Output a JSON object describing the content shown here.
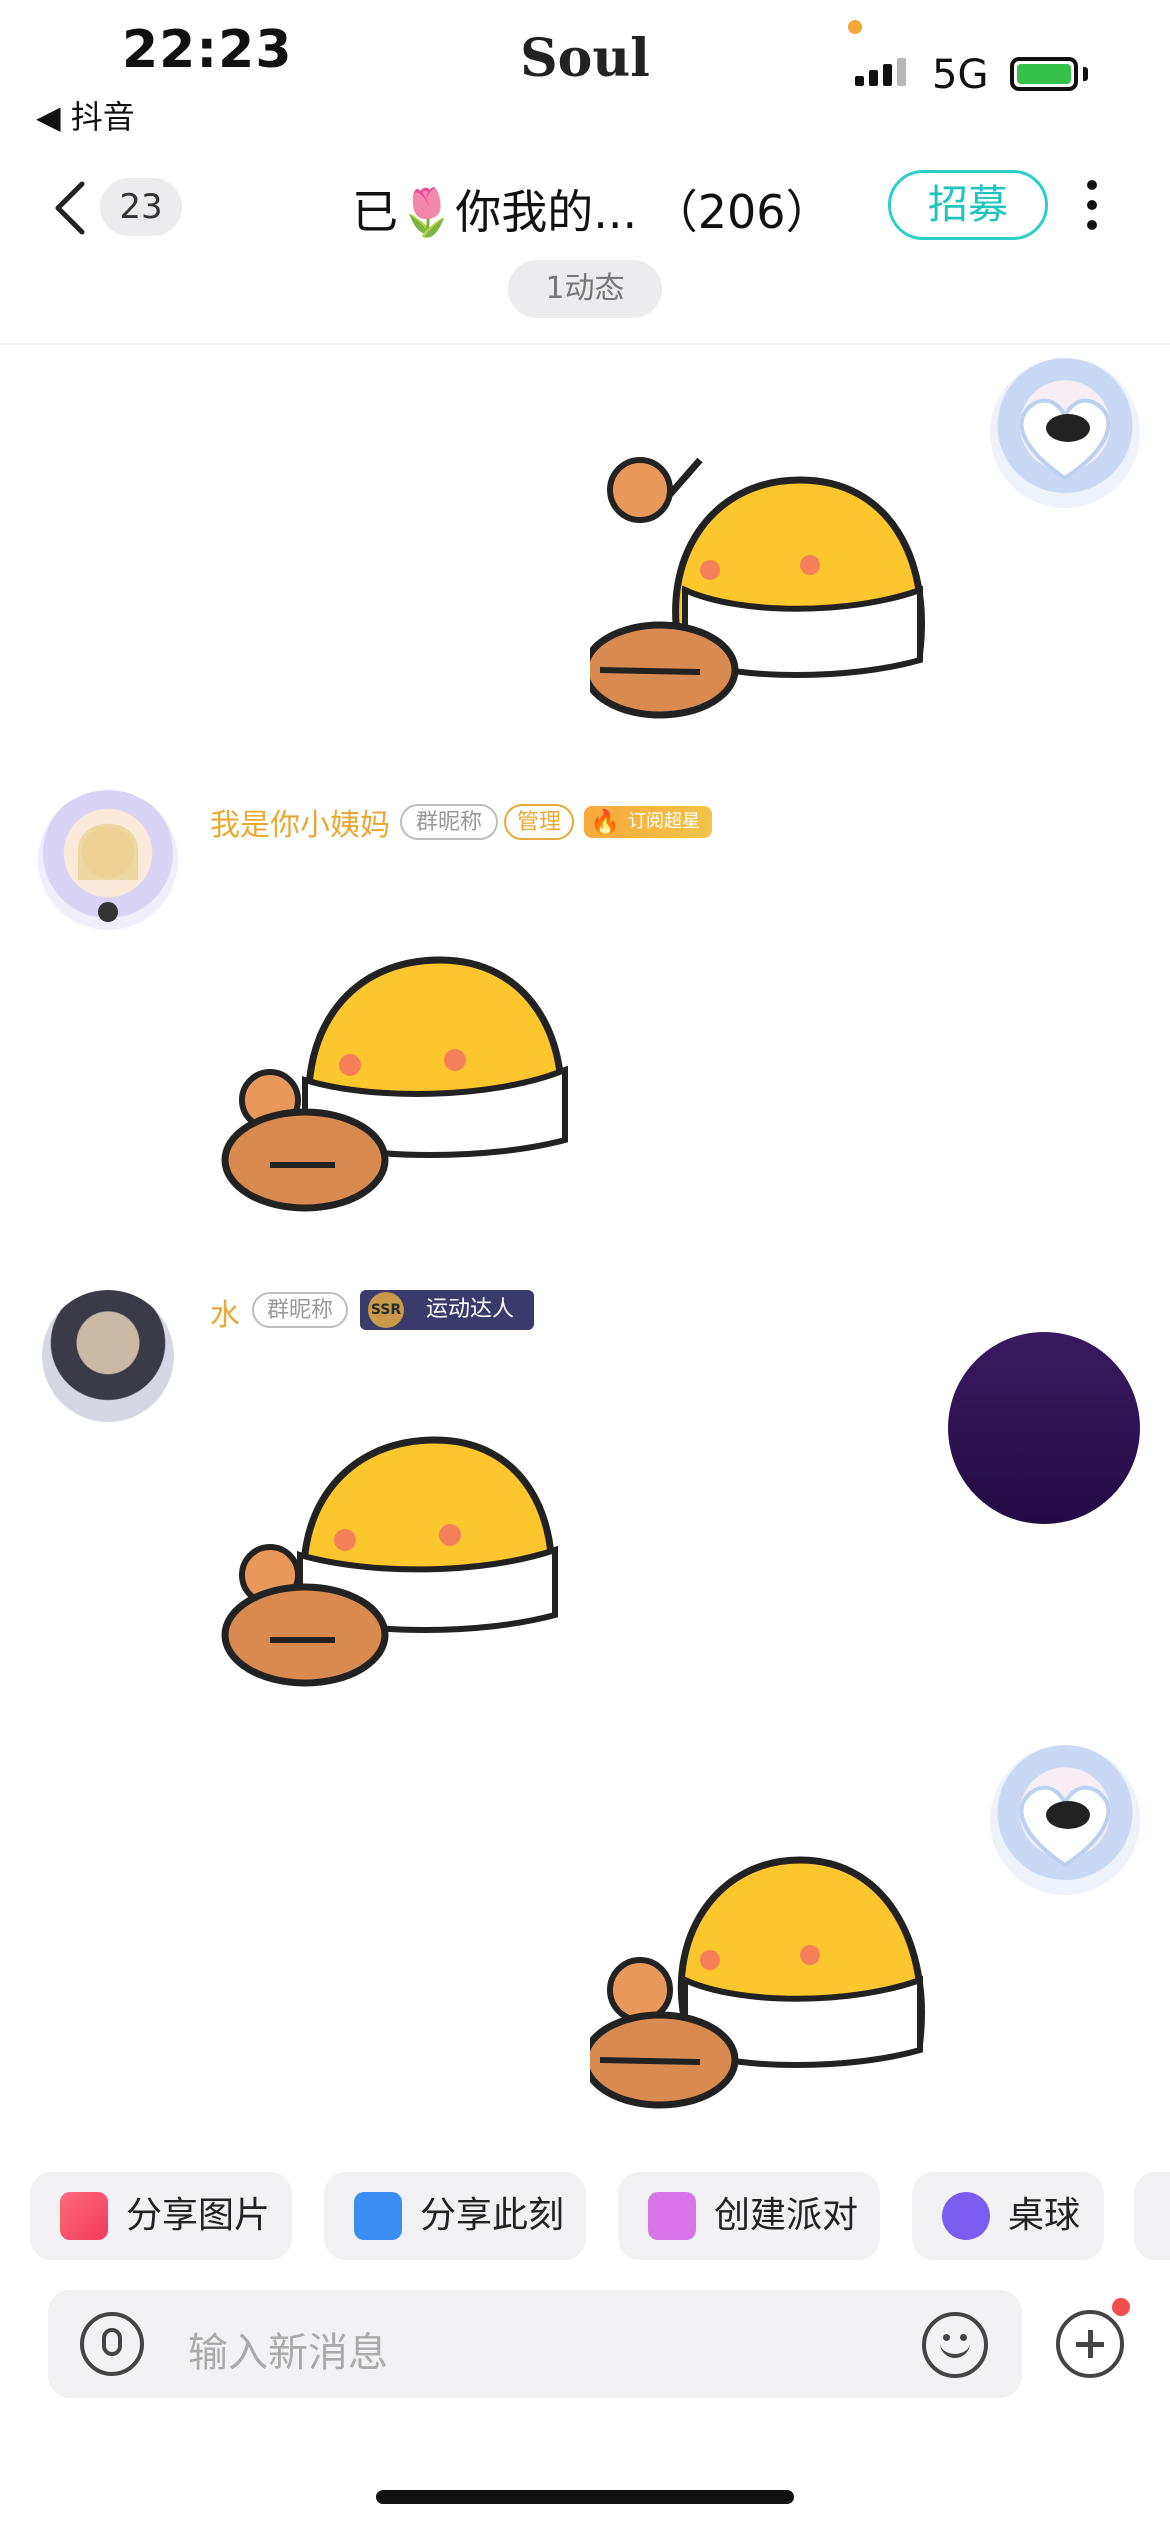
{
  "status_bar": {
    "time": "22:23",
    "back_app": "◀ 抖音",
    "app_name": "Soul",
    "network": "5G"
  },
  "header": {
    "unread_count": "23",
    "title": "已🌷你我的... （206）",
    "recruit_label": "招募",
    "moments_label": "1动态"
  },
  "messages": [
    {
      "side": "right",
      "type": "sticker"
    },
    {
      "side": "left",
      "type": "sticker",
      "nickname": "我是你小姨妈",
      "tags": [
        "群昵称",
        "管理"
      ],
      "badge": "订阅超星"
    },
    {
      "side": "left",
      "type": "sticker",
      "nickname": "水",
      "tags": [
        "群昵称"
      ],
      "badge": "运动达人",
      "badge_icon": "SSR"
    },
    {
      "side": "right",
      "type": "sticker"
    }
  ],
  "quick_actions": [
    {
      "label": "分享图片",
      "icon": "image-icon"
    },
    {
      "label": "分享此刻",
      "icon": "camera-icon"
    },
    {
      "label": "创建派对",
      "icon": "party-house-icon"
    },
    {
      "label": "桌球",
      "icon": "billiards-icon"
    }
  ],
  "input": {
    "placeholder": "输入新消息"
  },
  "colors": {
    "accent": "#1fc4bc",
    "nickname": "#e8a835",
    "battery": "#36c24a"
  }
}
